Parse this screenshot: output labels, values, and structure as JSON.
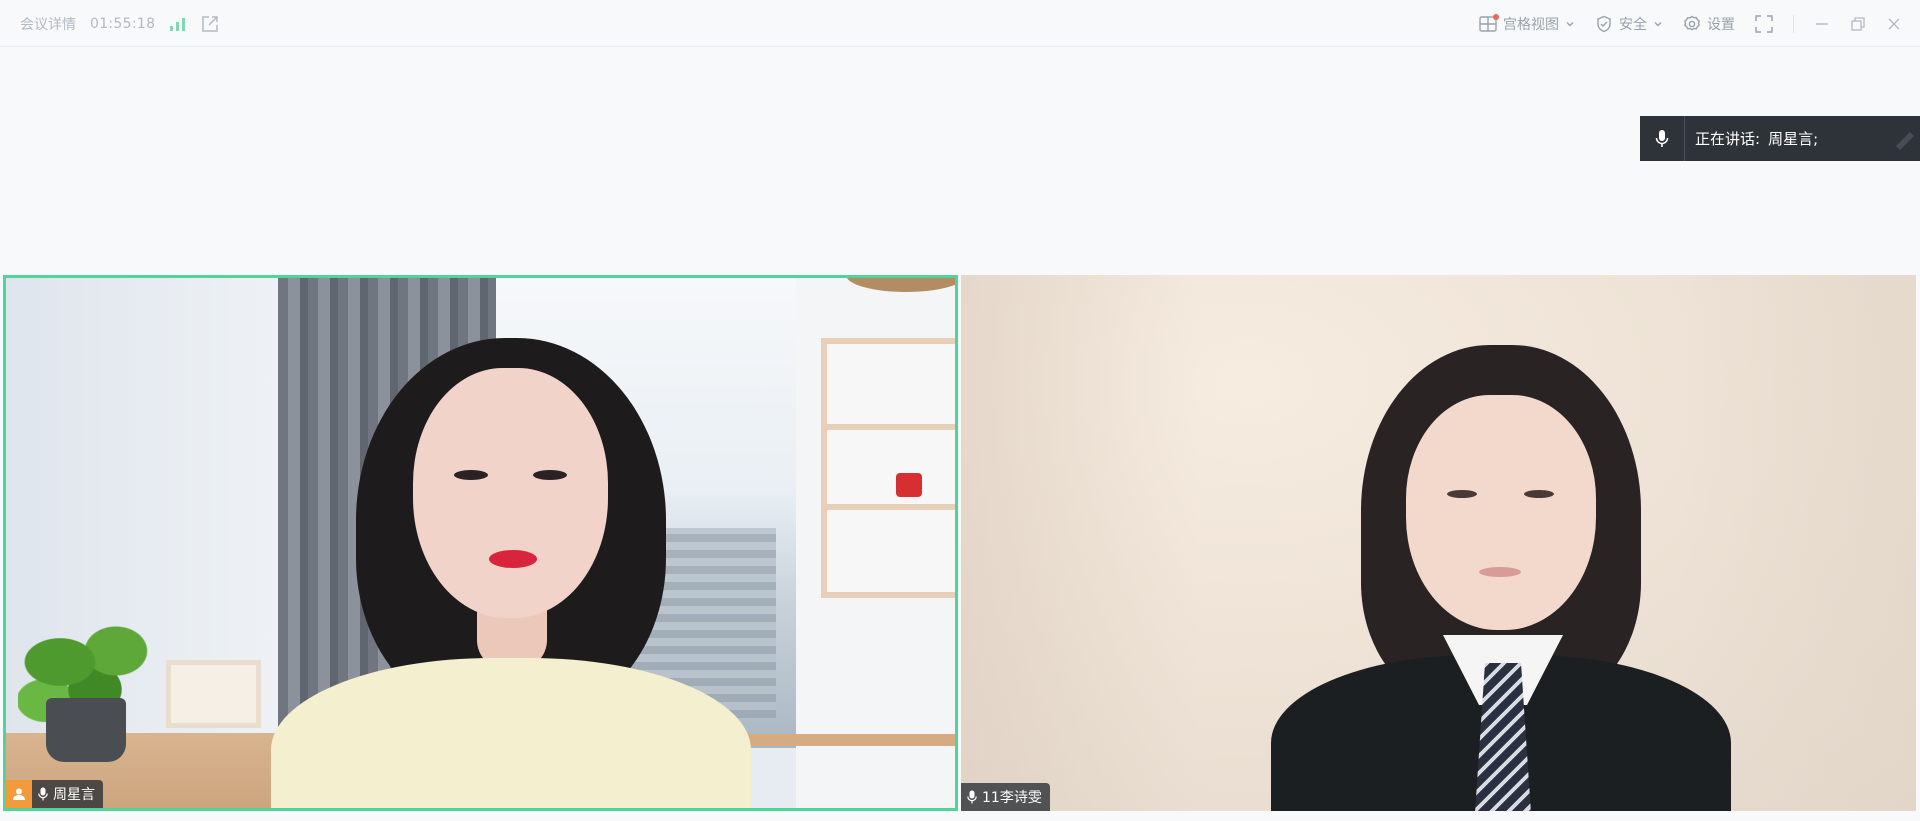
{
  "topbar": {
    "meeting_details_label": "会议详情",
    "meeting_duration": "01:55:18",
    "signal_icon": "signal-bars-icon",
    "share_icon": "external-link-icon",
    "grid_view_label": "宫格视图",
    "security_label": "安全",
    "settings_label": "设置"
  },
  "speaking_banner": {
    "label": "正在讲话:",
    "names": "周星言;"
  },
  "participants": [
    {
      "name": "周星言",
      "is_host": true,
      "active_speaker": true
    },
    {
      "name": "11李诗雯",
      "is_host": false,
      "active_speaker": false
    }
  ],
  "colors": {
    "active_speaker_border": "#4fd49b",
    "host_badge": "#f39a3b",
    "speaking_banner_bg": "#2e3339",
    "topbar_bg": "#f7f9fa"
  }
}
